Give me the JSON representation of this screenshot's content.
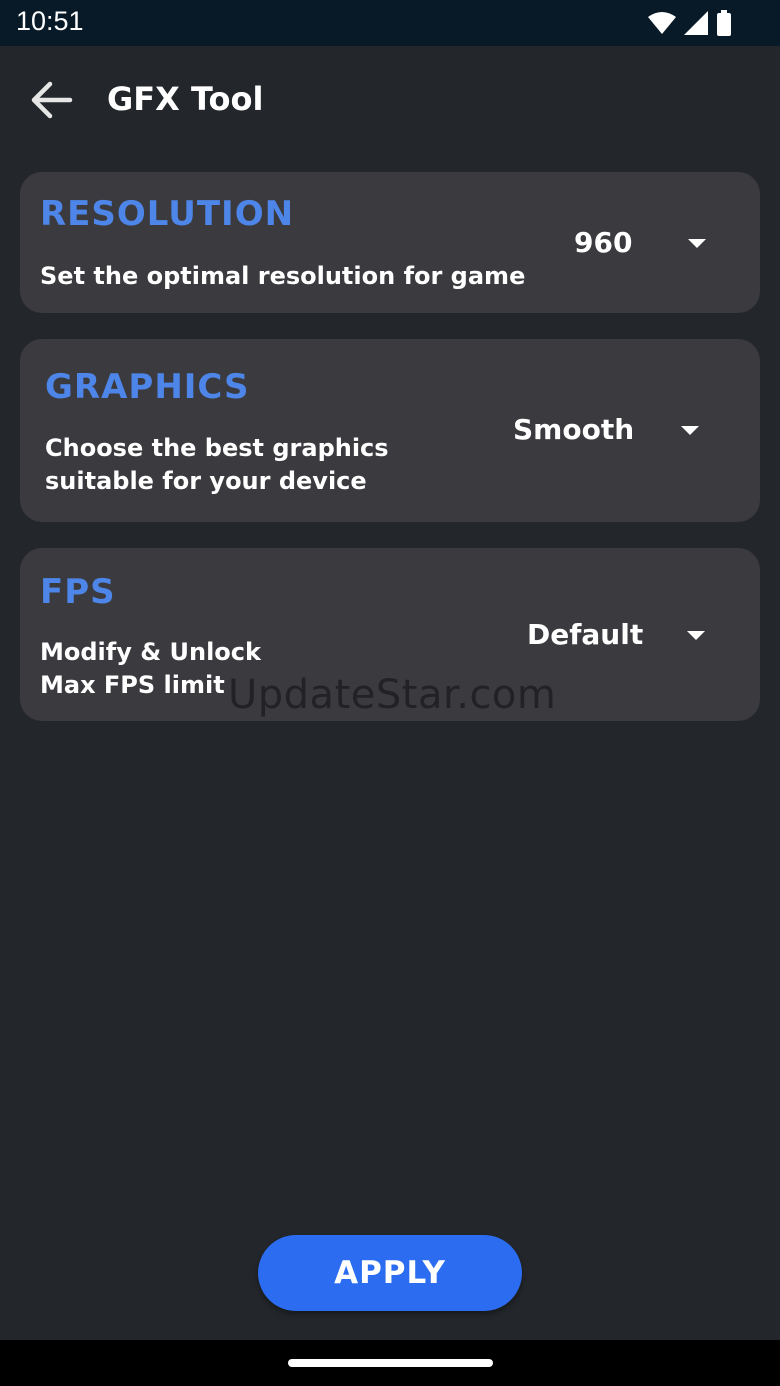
{
  "status_bar": {
    "time": "10:51",
    "icons": [
      "wifi-icon",
      "signal-icon",
      "battery-icon"
    ]
  },
  "app_bar": {
    "back_icon": "arrow-left-icon",
    "title": "GFX Tool"
  },
  "settings": {
    "resolution": {
      "title": "RESOLUTION",
      "description": "Set the optimal resolution for game",
      "value": "960"
    },
    "graphics": {
      "title": "GRAPHICS",
      "description_line1": "Choose the best graphics",
      "description_line2": "suitable for your device",
      "value": "Smooth"
    },
    "fps": {
      "title": "FPS",
      "description_line1": "Modify & Unlock",
      "description_line2": "Max FPS limit",
      "value": "Default"
    }
  },
  "watermark": "UpdateStar.com",
  "apply_label": "APPLY",
  "colors": {
    "background": "#23262a",
    "card": "#3b3a3e",
    "title_accent": "#4d86e8",
    "button": "#2b6cf0",
    "status_bar": "#081a28"
  }
}
